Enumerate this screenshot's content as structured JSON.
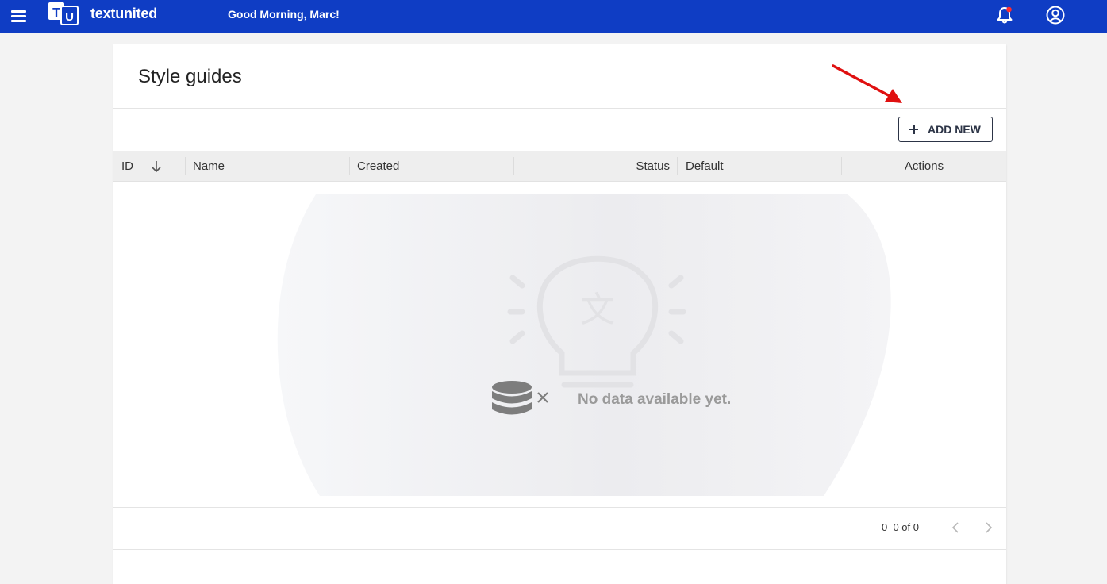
{
  "header": {
    "brand": "textunited",
    "logo_letters": [
      "T",
      "U"
    ],
    "greeting": "Good Morning, Marc!",
    "menu_icon": "hamburger-menu-icon",
    "notification_icon": "bell-icon",
    "account_icon": "user-circle-icon",
    "brand_color": "#0f3dc4",
    "notification_dot_color": "#ff2d2d"
  },
  "page": {
    "title": "Style guides",
    "add_button_label": "ADD NEW"
  },
  "table": {
    "columns": [
      {
        "label": "ID",
        "sorted": "desc"
      },
      {
        "label": "Name"
      },
      {
        "label": "Created"
      },
      {
        "label": "Status"
      },
      {
        "label": "Default"
      },
      {
        "label": "Actions"
      }
    ],
    "rows": []
  },
  "empty_state": {
    "message": "No data available yet."
  },
  "pagination": {
    "range_text": "0–0 of 0"
  },
  "annotation": {
    "arrow_color": "#e01010"
  }
}
